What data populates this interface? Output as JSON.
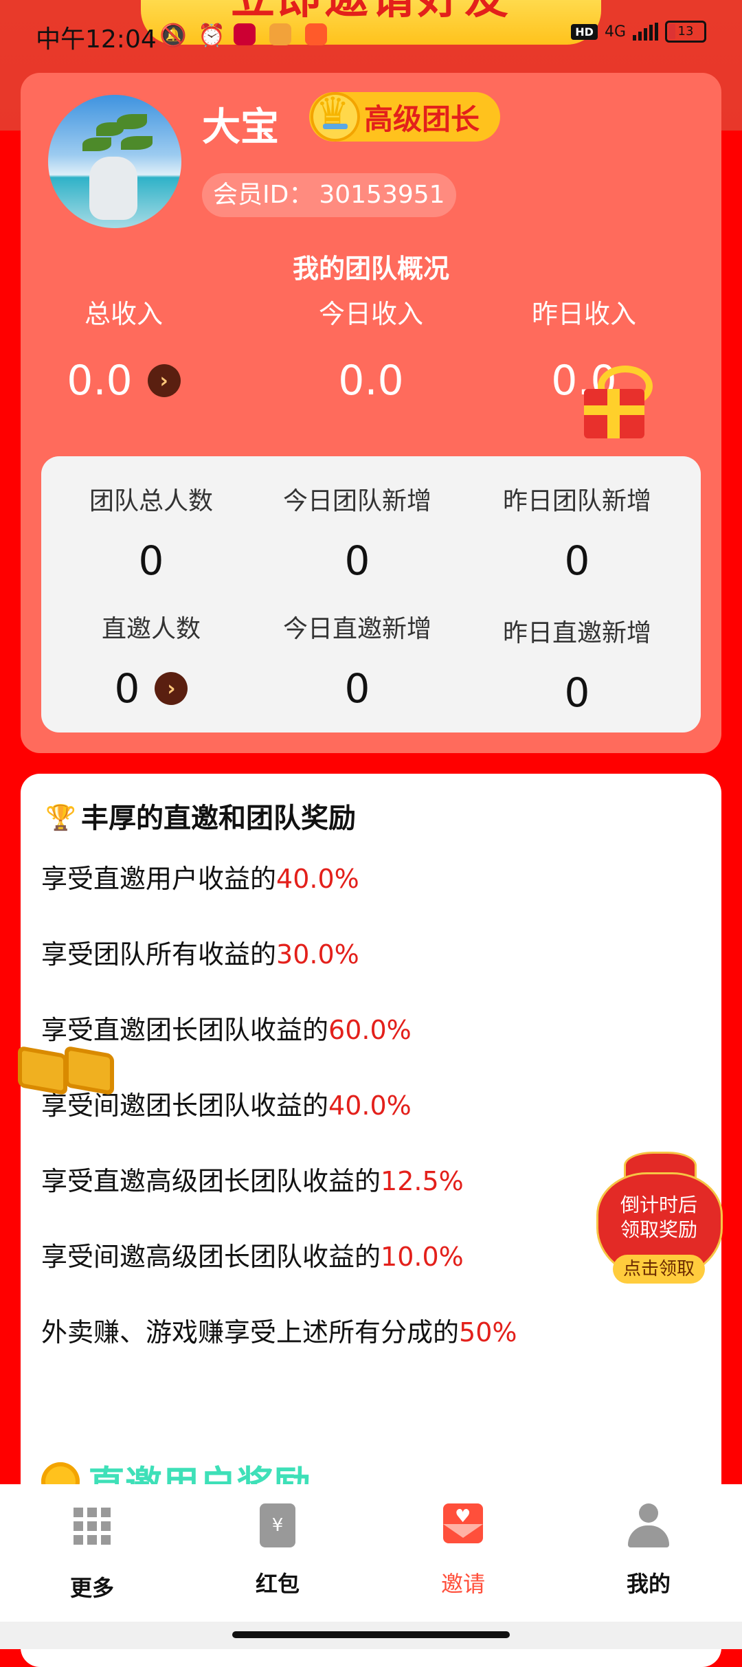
{
  "status_bar": {
    "time": "中午12:04",
    "network": "4G",
    "hd": "HD",
    "battery": "13"
  },
  "banner": {
    "text": "立即邀请好友"
  },
  "profile": {
    "username": "大宝",
    "rank": "高级团长",
    "member_id_label": "会员ID：",
    "member_id": "30153951"
  },
  "team_overview": {
    "title": "我的团队概况",
    "income": [
      {
        "label": "总收入",
        "value": "0.0"
      },
      {
        "label": "今日收入",
        "value": "0.0"
      },
      {
        "label": "昨日收入",
        "value": "0.0"
      }
    ],
    "stats": [
      {
        "label": "团队总人数",
        "value": "0"
      },
      {
        "label": "今日团队新增",
        "value": "0"
      },
      {
        "label": "昨日团队新增",
        "value": "0"
      },
      {
        "label": "直邀人数",
        "value": "0"
      },
      {
        "label": "今日直邀新增",
        "value": "0"
      },
      {
        "label": "昨日直邀新增",
        "value": "0"
      }
    ]
  },
  "rewards": {
    "title": "丰厚的直邀和团队奖励",
    "lines": [
      {
        "text": "享受直邀用户收益的",
        "pct": "40.0%"
      },
      {
        "text": "享受团队所有收益的",
        "pct": "30.0%"
      },
      {
        "text": "享受直邀团长团队收益的",
        "pct": "60.0%"
      },
      {
        "text": "享受间邀团长团队收益的",
        "pct": "40.0%"
      },
      {
        "text": "享受直邀高级团长团队收益的",
        "pct": "12.5%"
      },
      {
        "text": "享受间邀高级团长团队收益的",
        "pct": "10.0%"
      },
      {
        "text": "外卖赚、游戏赚享受上述所有分成的",
        "pct": "50%"
      }
    ],
    "direct_title": "直邀用户奖励"
  },
  "countdown_bag": {
    "line1": "倒计时后",
    "line2": "领取奖励",
    "button": "点击领取"
  },
  "bottom_nav": [
    {
      "label": "更多",
      "icon": "grid-icon"
    },
    {
      "label": "红包",
      "icon": "red-envelope-icon"
    },
    {
      "label": "邀请",
      "icon": "invite-envelope-icon",
      "active": true
    },
    {
      "label": "我的",
      "icon": "person-icon"
    }
  ],
  "colors": {
    "background": "#ff0000",
    "card": "#ff6b5c",
    "accent_red": "#e3201b",
    "gold": "#ffc21d",
    "active_tab": "#ff4f3b",
    "teal_title": "#3ee0b8"
  }
}
